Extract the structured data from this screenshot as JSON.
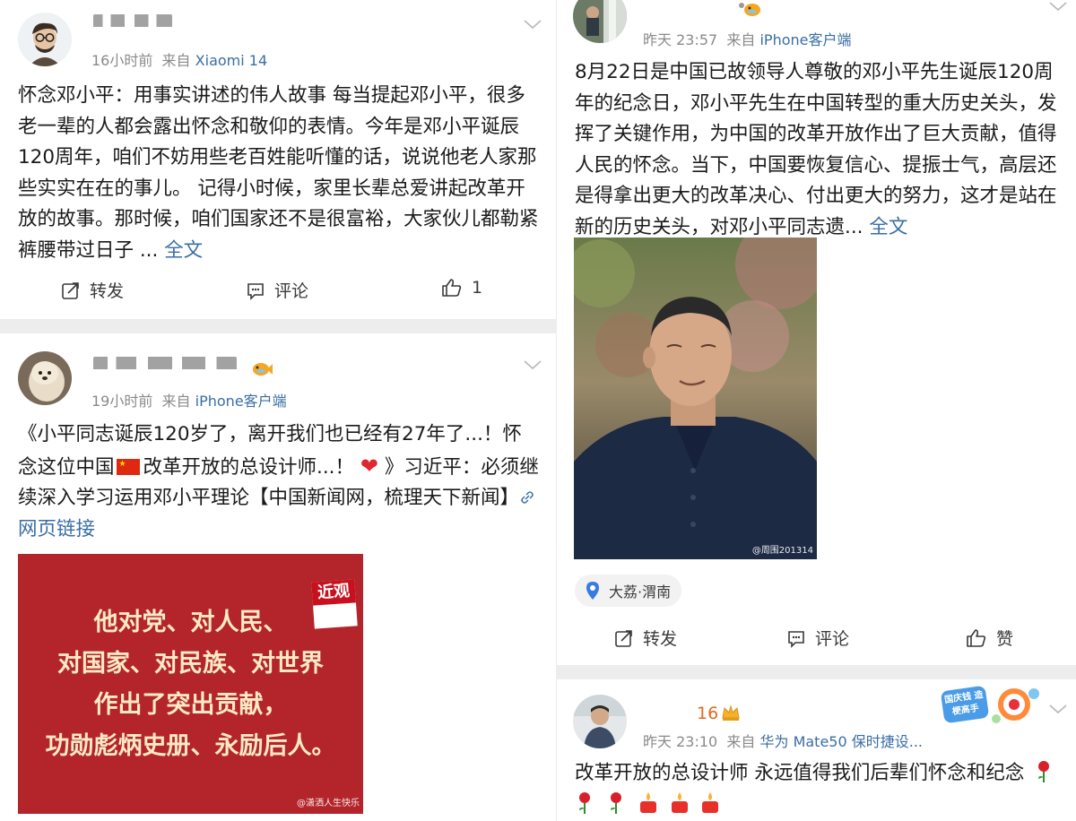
{
  "posts": [
    {
      "time": "16小时前",
      "via": "来自",
      "source": "Xiaomi 14",
      "body": "怀念邓小平：用事实讲述的伟人故事 每当提起邓小平，很多老一辈的人都会露出怀念和敬仰的表情。今年是邓小平诞辰120周年，咱们不妨用些老百姓能听懂的话，说说他老人家那些实实在在的事儿。 记得小时候，家里长辈总爱讲起改革开放的故事。那时候，咱们国家还不是很富裕，大家伙儿都勒紧裤腰带过日子 ... ",
      "more": "全文",
      "repost": "转发",
      "comment": "评论",
      "like": "1"
    },
    {
      "time": "19小时前",
      "via": "来自",
      "source": "iPhone客户端",
      "body_a": "《小平同志诞辰120岁了，离开我们也已经有27年了...！怀念这位中国",
      "body_b": "改革开放的总设计师...！",
      "body_c": "》习近平：必须继续深入学习运用邓小平理论【中国新闻网，梳理天下新闻】",
      "link": "网页链接",
      "image_lines": [
        "他对党、对人民、",
        "对国家、对民族、对世界",
        "作出了突出贡献，",
        "功勋彪炳史册、永励后人。"
      ],
      "image_logo": "近观",
      "image_watermark": "@潇洒人生快乐"
    },
    {
      "time": "昨天 23:57",
      "via": "来自",
      "source": "iPhone客户端",
      "body": "8月22日是中国已故领导人尊敬的邓小平先生诞辰120周年的纪念日，邓小平先生在中国转型的重大历史关头，发挥了关键作用，为中国的改革开放作出了巨大贡献，值得人民的怀念。当下，中国要恢复信心、提振士气，高层还是得拿出更大的改革决心、付出更大的努力，这才是站在新的历史关头，对邓小平同志遗... ",
      "more": "全文",
      "photo_watermark": "@周围201314",
      "location": "大荔·渭南",
      "repost": "转发",
      "comment": "评论",
      "like": "赞"
    },
    {
      "name_num": "16",
      "time": "昨天 23:10",
      "via": "来自",
      "source": "华为 Mate50 保时捷设...",
      "body": "改革开放的总设计师 永远值得我们后辈们怀念和纪念",
      "badge_text": "国庆钱 造梗高手"
    }
  ],
  "colors": {
    "link": "#3a6ea5",
    "meta": "#8a8a8a",
    "separator": "#ededed",
    "red_image": "#b3252a"
  }
}
